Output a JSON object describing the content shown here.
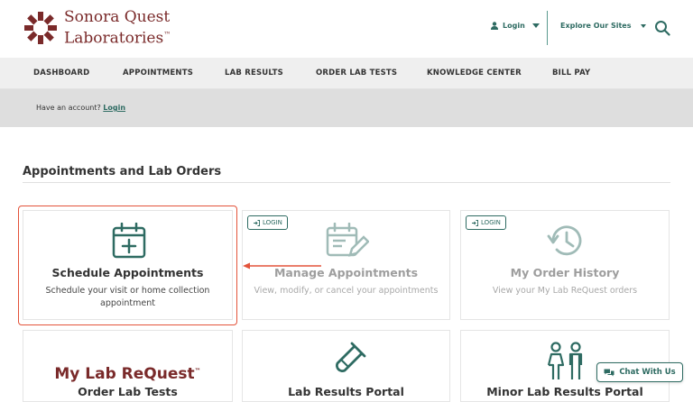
{
  "brand": {
    "line1": "Sonora Quest",
    "line2": "Laboratories",
    "trademark": "™",
    "color": "#7a2a2a",
    "accent": "#2e6b62"
  },
  "header": {
    "login_label": "Login",
    "explore_label": "Explore Our Sites",
    "search_icon": "search-icon"
  },
  "nav": {
    "items": [
      "DASHBOARD",
      "APPOINTMENTS",
      "LAB RESULTS",
      "ORDER LAB TESTS",
      "KNOWLEDGE CENTER",
      "BILL PAY"
    ]
  },
  "banner": {
    "prompt": "Have an account? ",
    "login_link": "Login"
  },
  "section": {
    "title": "Appointments and Lab Orders"
  },
  "cards": [
    {
      "title": "Schedule Appointments",
      "subtitle_line1": "Schedule your visit or home collection",
      "subtitle_line2": "appointment",
      "icon": "calendar-plus-icon",
      "requires_login": false
    },
    {
      "title": "Manage Appointments",
      "subtitle": "View, modify, or cancel your appointments",
      "icon": "calendar-edit-icon",
      "requires_login": true,
      "badge": "LOGIN"
    },
    {
      "title": "My Order History",
      "subtitle": "View your My Lab ReQuest orders",
      "icon": "history-icon",
      "requires_login": true,
      "badge": "LOGIN"
    },
    {
      "title": "Order Lab Tests",
      "logo_text_a": "My Lab Re",
      "logo_text_b": "Quest",
      "logo_tm": "™",
      "icon": "my-lab-request-logo"
    },
    {
      "title": "Lab Results Portal",
      "icon": "test-tube-icon"
    },
    {
      "title": "Minor Lab Results Portal",
      "icon": "family-icon"
    }
  ],
  "chat": {
    "label": "Chat With Us",
    "icon": "chat-bubbles-icon"
  }
}
